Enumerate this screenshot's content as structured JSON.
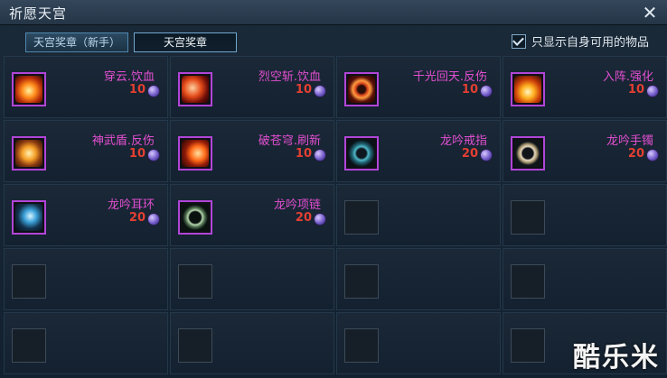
{
  "window": {
    "title": "祈愿天宫"
  },
  "tabs": [
    {
      "label": "天宫奖章（新手）"
    },
    {
      "label": "天宫奖章"
    }
  ],
  "filter": {
    "label": "只显示自身可用的物品",
    "checked": true
  },
  "items": [
    {
      "name": "穿云.饮血",
      "price": "10",
      "icon": "fire-slash-icon"
    },
    {
      "name": "烈空斩.饮血",
      "price": "10",
      "icon": "red-crescent-icon"
    },
    {
      "name": "千光回天.反伤",
      "price": "10",
      "icon": "fire-ring-icon"
    },
    {
      "name": "入阵.强化",
      "price": "10",
      "icon": "flame-burst-icon"
    },
    {
      "name": "神武盾.反伤",
      "price": "10",
      "icon": "golden-shield-icon"
    },
    {
      "name": "破苍穹.刷新",
      "price": "10",
      "icon": "fire-bow-icon"
    },
    {
      "name": "龙吟戒指",
      "price": "20",
      "icon": "dragon-ring-icon"
    },
    {
      "name": "龙吟手镯",
      "price": "20",
      "icon": "dragon-bracelet-icon"
    },
    {
      "name": "龙吟耳环",
      "price": "20",
      "icon": "dragon-earring-icon"
    },
    {
      "name": "龙吟项链",
      "price": "20",
      "icon": "dragon-necklace-icon"
    }
  ],
  "empty_slots": 10,
  "currency_icon": "medal-coin-icon",
  "watermark": "酷乐米",
  "colors": {
    "item_name": "#e24fd0",
    "price": "#e33f32",
    "slot_border": "#b245d8"
  }
}
